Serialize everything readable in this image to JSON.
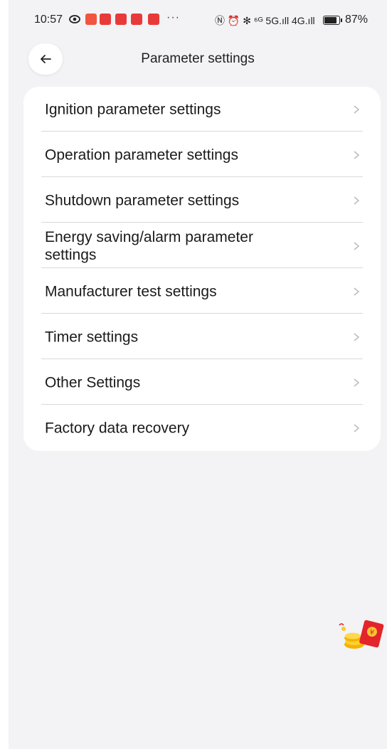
{
  "status_bar": {
    "time": "10:57",
    "dots": "···",
    "signal_text": "Ⓝ ⏰ ✻ ⁶ᴳ 5G.ıll 4G.ıll",
    "battery": "87%"
  },
  "header": {
    "title": "Parameter settings"
  },
  "menu": {
    "items": [
      {
        "label": "Ignition parameter settings"
      },
      {
        "label": "Operation parameter settings"
      },
      {
        "label": "Shutdown parameter settings"
      },
      {
        "label": "Energy saving/alarm parameter settings"
      },
      {
        "label": "Manufacturer test settings"
      },
      {
        "label": "Timer settings"
      },
      {
        "label": "Other Settings"
      },
      {
        "label": "Factory data recovery"
      }
    ]
  },
  "colors": {
    "background": "#f3f3f5",
    "card": "#ffffff",
    "chevron": "#bdbdbd",
    "app_badge": "#e83a3a",
    "app_badge_alt": "#f2553f"
  },
  "icons": {
    "back": "arrow-left-icon",
    "chevron": "chevron-right-icon",
    "ad": "red-envelope-coins-icon"
  }
}
